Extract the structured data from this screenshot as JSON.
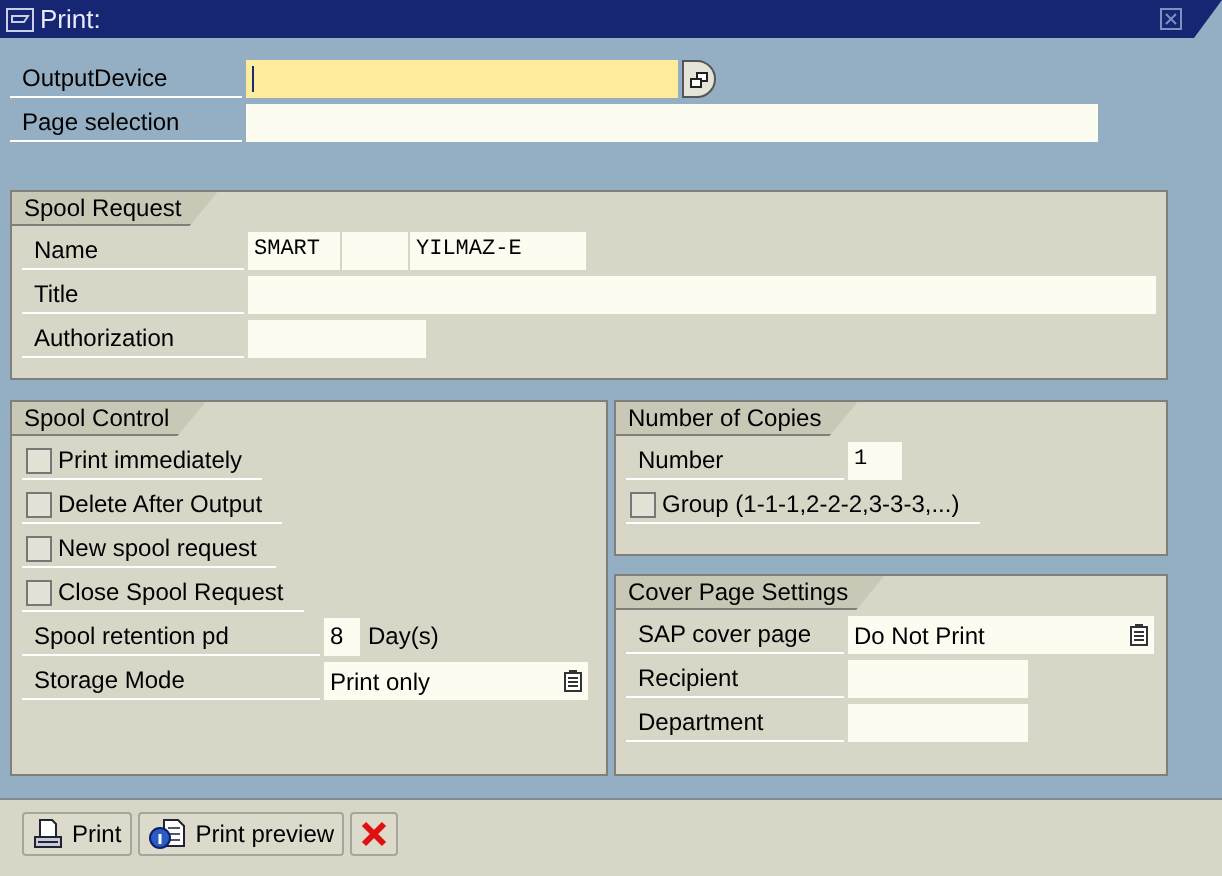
{
  "window": {
    "title": "Print:"
  },
  "top_fields": [
    {
      "kind": "lookup",
      "label": "OutputDevice",
      "focused": true
    },
    {
      "kind": "field",
      "label": "Page selection",
      "focused": false
    }
  ],
  "spool_request": {
    "title": "Spool Request",
    "rows": [
      {
        "kind": "name",
        "label": "Name",
        "values": [
          "SMART",
          "YILMAZ-E"
        ]
      },
      {
        "kind": "field",
        "label": "Title"
      },
      {
        "kind": "field",
        "label": "Authorization"
      }
    ]
  },
  "spool_control": {
    "title": "Spool Control",
    "rows": [
      {
        "kind": "checkbox",
        "label": "Print immediately",
        "checked": false
      },
      {
        "kind": "checkbox",
        "label": "Delete After Output",
        "checked": false
      },
      {
        "kind": "checkbox",
        "label": "New spool request",
        "checked": false
      },
      {
        "kind": "checkbox",
        "label": "Close Spool Request",
        "checked": false
      },
      {
        "kind": "field",
        "label": "Spool retention pd",
        "value": "8",
        "unit": "Day(s)"
      },
      {
        "kind": "dropdown",
        "label": "Storage Mode",
        "value": "Print only"
      }
    ]
  },
  "number_of_copies": {
    "title": "Number of Copies",
    "rows": [
      {
        "kind": "field",
        "label": "Number",
        "value": "1"
      },
      {
        "kind": "checkbox",
        "label": "Group (1-1-1,2-2-2,3-3-3,...)",
        "checked": false
      }
    ]
  },
  "cover_page_settings": {
    "title": "Cover Page Settings",
    "rows": [
      {
        "kind": "dropdown",
        "label": "SAP cover page",
        "value": "Do Not Print"
      },
      {
        "kind": "field",
        "label": "Recipient"
      },
      {
        "kind": "field",
        "label": "Department"
      }
    ]
  },
  "buttons": [
    {
      "kind": "print",
      "label": "Print"
    },
    {
      "kind": "preview",
      "label": "Print preview"
    },
    {
      "kind": "cancel"
    }
  ]
}
